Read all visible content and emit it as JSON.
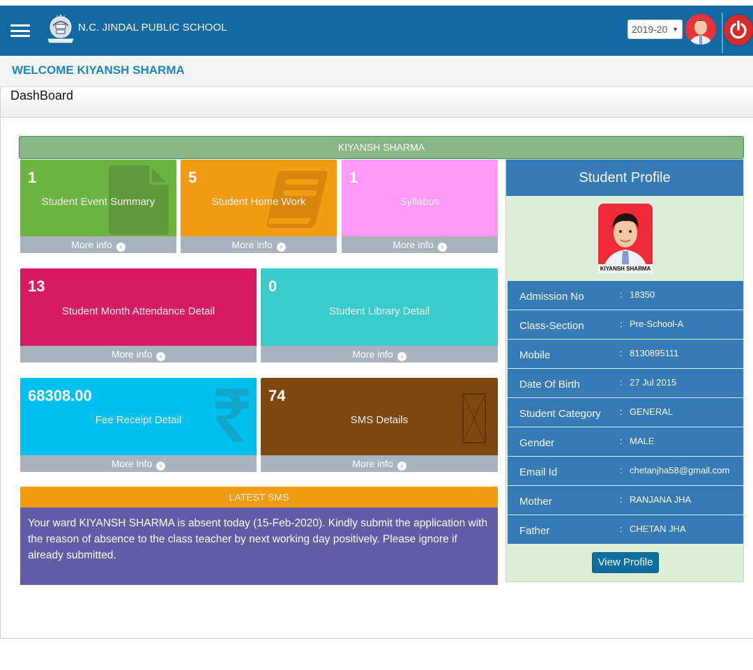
{
  "navbar": {
    "school_name": "N.C. JINDAL PUBLIC SCHOOL",
    "session": "2019-20",
    "menu_icon": "hamburger-icon",
    "logout_icon": "power-icon"
  },
  "welcome": {
    "text": "WELCOME KIYANSH SHARMA"
  },
  "page": {
    "title": "DashBoard"
  },
  "student_bar": {
    "name": "KIYANSH SHARMA"
  },
  "tiles": [
    {
      "value": "1",
      "label": "Student Event Summary",
      "more": "More info",
      "color": "#6db33f",
      "icon": "file-icon"
    },
    {
      "value": "5",
      "label": "Student Home Work",
      "more": "More info",
      "color": "#f39c12",
      "icon": "book-icon"
    },
    {
      "value": "1",
      "label": "Syllabus",
      "more": "More info",
      "color": "#ff99f7",
      "icon": ""
    },
    {
      "value": "13",
      "label": "Student Month Attendance Detail",
      "more": "More info",
      "color": "#d81b60",
      "icon": ""
    },
    {
      "value": "0",
      "label": "Student Library Detail",
      "more": "More info",
      "color": "#39cccc",
      "icon": ""
    },
    {
      "value": "68308.00",
      "label": "Fee Receipt Detail",
      "more": "More info",
      "color": "#00c0ef",
      "icon": "rupee-icon"
    },
    {
      "value": "74",
      "label": "SMS Details",
      "more": "More info",
      "color": "#7d470f",
      "icon": "broken-image-icon"
    }
  ],
  "latest_sms": {
    "title": "LATEST SMS",
    "message": "Your ward KIYANSH SHARMA is absent today (15-Feb-2020). Kindly submit the application with the reason of absence to the class teacher by next working day positively. Please ignore if already submitted."
  },
  "profile": {
    "title": "Student Profile",
    "photo_caption": "KIYANSH SHARMA",
    "fields": [
      {
        "label": "Admission No",
        "value": "18350"
      },
      {
        "label": "Class-Section",
        "value": "Pre-School-A"
      },
      {
        "label": "Mobile",
        "value": "8130895111"
      },
      {
        "label": "Date Of Birth",
        "value": "27 Jul 2015"
      },
      {
        "label": "Student Category",
        "value": "GENERAL"
      },
      {
        "label": "Gender",
        "value": "MALE"
      },
      {
        "label": "Email Id",
        "value": "chetanjha58@gmail.com"
      },
      {
        "label": "Mother",
        "value": "RANJANA JHA"
      },
      {
        "label": "Father",
        "value": "CHETAN JHA"
      }
    ],
    "separator": ":",
    "view_button": "View Profile"
  }
}
